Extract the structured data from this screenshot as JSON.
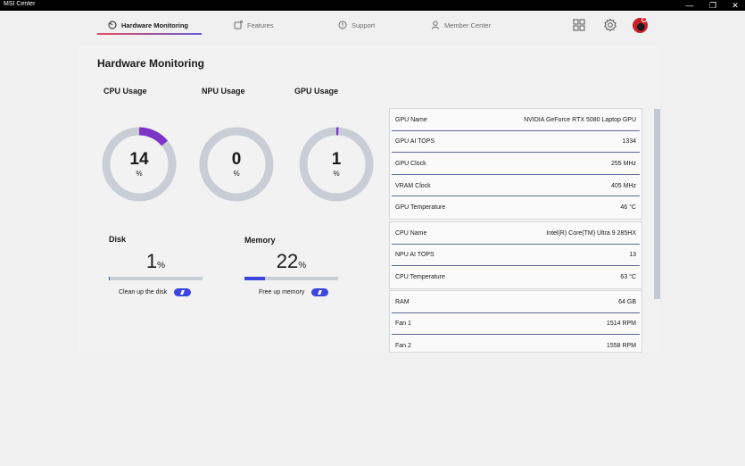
{
  "window": {
    "title": "MSI Center",
    "minimize_glyph": "—",
    "restore_glyph": "❐",
    "close_glyph": "✕"
  },
  "nav": {
    "tabs": [
      {
        "label": "Hardware Monitoring",
        "icon": "gauge-icon",
        "active": true
      },
      {
        "label": "Features",
        "icon": "features-icon",
        "active": false
      },
      {
        "label": "Support",
        "icon": "support-icon",
        "active": false
      },
      {
        "label": "Member Center",
        "icon": "member-icon",
        "active": false
      }
    ],
    "right_icons": [
      "grid-icon",
      "gear-icon",
      "avatar"
    ]
  },
  "page": {
    "title": "Hardware Monitoring"
  },
  "gauges": [
    {
      "label": "CPU Usage",
      "value": "14",
      "unit": "%",
      "percent": 14
    },
    {
      "label": "NPU Usage",
      "value": "0",
      "unit": "%",
      "percent": 0
    },
    {
      "label": "GPU Usage",
      "value": "1",
      "unit": "%",
      "percent": 1
    }
  ],
  "disk": {
    "label": "Disk",
    "value": "1",
    "unit": "%",
    "percent": 1,
    "action": "Clean up the disk"
  },
  "memory": {
    "label": "Memory",
    "value": "22",
    "unit": "%",
    "percent": 22,
    "action": "Free up memory"
  },
  "info": {
    "gpu": [
      {
        "key": "GPU Name",
        "value": "NVIDIA GeForce RTX 5080 Laptop GPU"
      },
      {
        "key": "GPU AI TOPS",
        "value": "1334"
      },
      {
        "key": "GPU Clock",
        "value": "255 MHz"
      },
      {
        "key": "VRAM Clock",
        "value": "405 MHz"
      },
      {
        "key": "GPU Temperature",
        "value": "46 °C"
      }
    ],
    "cpu": [
      {
        "key": "CPU Name",
        "value": "Intel(R) Core(TM) Ultra 9 285HX"
      },
      {
        "key": "NPU AI TOPS",
        "value": "13"
      },
      {
        "key": "CPU Temperature",
        "value": "63 °C"
      }
    ],
    "system": [
      {
        "key": "RAM",
        "value": "64 GB"
      },
      {
        "key": "Fan 1",
        "value": "1514 RPM"
      },
      {
        "key": "Fan 2",
        "value": "1558 RPM"
      }
    ]
  },
  "colors": {
    "gauge_track": "#c8cdd6",
    "gauge_fill": "#7b35c7",
    "accent_blue": "#3b46e0"
  }
}
